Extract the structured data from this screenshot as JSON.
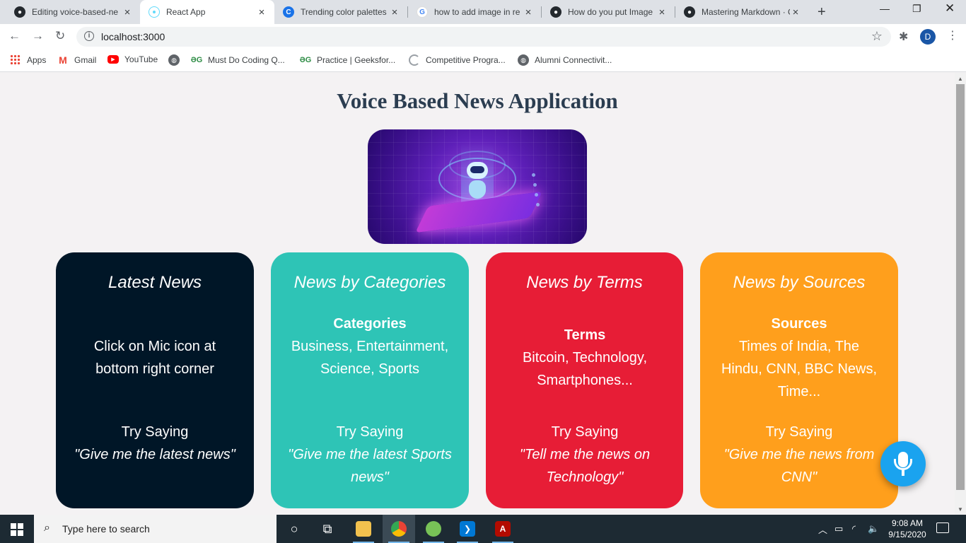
{
  "browser": {
    "tabs": [
      {
        "title": "Editing voice-based-ne",
        "favicon": "github-icon"
      },
      {
        "title": "React App",
        "favicon": "react-icon"
      },
      {
        "title": "Trending color palettes",
        "favicon": "coolors-icon"
      },
      {
        "title": "how to add image in re",
        "favicon": "google-icon"
      },
      {
        "title": "How do you put Image",
        "favicon": "github-icon"
      },
      {
        "title": "Mastering Markdown · G",
        "favicon": "github-icon"
      }
    ],
    "url": "localhost:3000",
    "profile_initial": "D",
    "bookmarks": [
      {
        "label": "Apps",
        "icon": "apps-grid-icon"
      },
      {
        "label": "Gmail",
        "icon": "gmail-icon"
      },
      {
        "label": "YouTube",
        "icon": "youtube-icon"
      },
      {
        "label": "",
        "icon": "globe-icon"
      },
      {
        "label": "Must Do Coding Q...",
        "icon": "gfg-icon"
      },
      {
        "label": "Practice | Geeksfor...",
        "icon": "gfg-icon"
      },
      {
        "label": "Competitive Progra...",
        "icon": "loading-icon"
      },
      {
        "label": "Alumni Connectivit...",
        "icon": "globe-icon"
      }
    ]
  },
  "page": {
    "title": "Voice Based News Application",
    "cards": [
      {
        "title": "Latest News",
        "color": "#001627",
        "label": "",
        "body": "Click on Mic icon at bottom right corner",
        "try": "Try Saying",
        "quote": "\"Give me the latest news\""
      },
      {
        "title": "News by Categories",
        "color": "#2ec4b6",
        "label": "Categories",
        "body": "Business, Entertainment, Science, Sports",
        "try": "Try Saying",
        "quote": "\"Give me the latest Sports news\""
      },
      {
        "title": "News by Terms",
        "color": "#e71d36",
        "label": "Terms",
        "body": "Bitcoin, Technology, Smartphones...",
        "try": "Try Saying",
        "quote": "\"Tell me the news on Technology\""
      },
      {
        "title": "News by Sources",
        "color": "#ff9f1c",
        "label": "Sources",
        "body": "Times of India, The Hindu, CNN, BBC News, Time...",
        "try": "Try Saying",
        "quote": "\"Give me the news from CNN\""
      }
    ],
    "mic_color": "#1aa3ef"
  },
  "taskbar": {
    "search_placeholder": "Type here to search",
    "time": "9:08 AM",
    "date": "9/15/2020"
  }
}
